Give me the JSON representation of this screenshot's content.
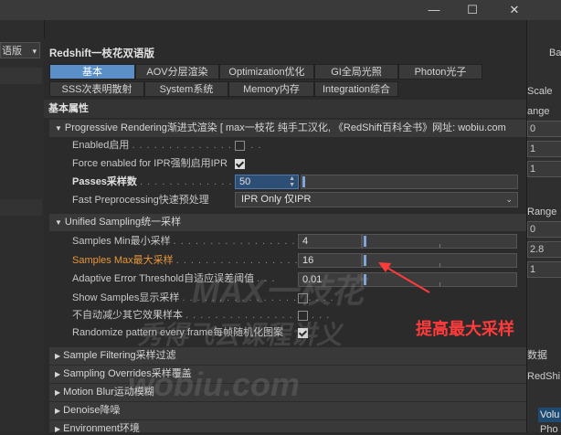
{
  "window": {
    "minimize": "—",
    "maximize": "☐",
    "close": "✕"
  },
  "left_panel": {
    "dropdown_label": "语版"
  },
  "right_panel": {
    "ba": "Ba",
    "scale": "Scale",
    "range1": "ange",
    "v0a": "0",
    "v1a": "1",
    "v1b": "1",
    "range2": "Range",
    "v0b": "0",
    "v28": "2.8",
    "v1c": "1",
    "data": "数据",
    "redshi": "RedShi",
    "volu": "Volu",
    "pho": "Pho"
  },
  "panel": {
    "title": "Redshift一枝花双语版",
    "tabs_row1": [
      "基本",
      "AOV分层渲染",
      "Optimization优化",
      "GI全局光照",
      "Photon光子"
    ],
    "tabs_row2": [
      "SSS次表明散射",
      "System系统",
      "Memory内存",
      "Integration综合"
    ],
    "active_tab": "基本",
    "section_title": "基本属性"
  },
  "progressive": {
    "header": "Progressive Rendering渐进式渲染 [ max一枝花 纯手工汉化, 《RedShift百科全书》网址: wobiu.com",
    "enabled_label": "Enabled启用",
    "enabled_checked": false,
    "force_ipr_label": "Force enabled for IPR强制启用IPR",
    "force_ipr_checked": true,
    "passes_label": "Passes采样数",
    "passes_value": "50",
    "passes_fill": 0.02,
    "fast_label": "Fast Preprocessing快速预处理",
    "fast_value": "IPR Only 仅IPR"
  },
  "unified": {
    "header": "Unified Sampling统一采样",
    "samples_min_label": "Samples Min最小采样",
    "samples_min_value": "4",
    "samples_max_label": "Samples Max最大采样",
    "samples_max_value": "16",
    "adaptive_label": "Adaptive Error Threshold自适应误差阈值",
    "adaptive_value": "0.01",
    "show_samples_label": "Show Samples显示采样",
    "show_samples_checked": false,
    "no_auto_label": "不自动减少其它效果样本",
    "no_auto_checked": false,
    "randomize_label": "Randomize pattern every frame每帧随机化图案",
    "randomize_checked": true
  },
  "collapsed_groups": [
    "Sample Filtering采样过滤",
    "Sampling Overrides采样覆盖",
    "Motion Blur运动模糊",
    "Denoise降噪",
    "Environment环境"
  ],
  "annotation": {
    "text": "提高最大采样",
    "color": "#ff3b3b"
  },
  "watermark": {
    "line1": "MAX一枝花",
    "line2": "秀得飞云课程讲义",
    "line3": "wobiu.com"
  },
  "colors": {
    "accent": "#5a8fc7",
    "highlight_label": "#e8963a",
    "annotation": "#ff3b3b"
  }
}
